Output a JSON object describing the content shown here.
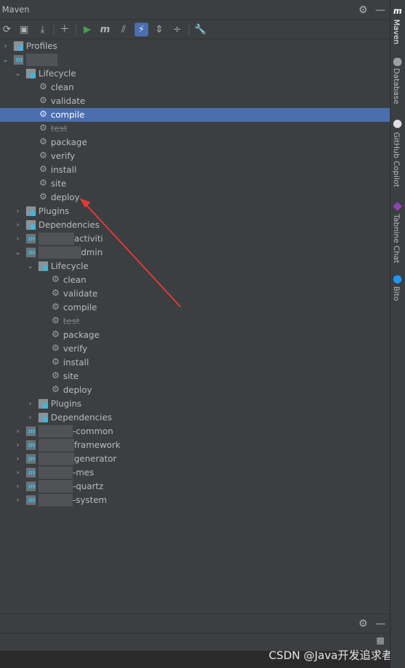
{
  "window": {
    "title": "Maven"
  },
  "header_icons": [
    "gear-icon",
    "minimize-icon"
  ],
  "toolbar": {
    "buttons": [
      "reload-icon",
      "add-project-icon",
      "download-icon",
      "add-icon",
      "run-icon",
      "maven-goal-icon",
      "toggle-offline-icon",
      "skip-tests-icon",
      "expand-all-icon",
      "collapse-all-icon",
      "settings-wrench-icon"
    ]
  },
  "tree": {
    "profiles": "Profiles",
    "root": {
      "lifecycle": "Lifecycle",
      "goals": [
        "clean",
        "validate",
        "compile",
        "test",
        "package",
        "verify",
        "install",
        "site",
        "deploy"
      ],
      "plugins": "Plugins",
      "dependencies": "Dependencies"
    },
    "modules": [
      {
        "suffix": "activiti"
      },
      {
        "suffix": "dmin"
      }
    ],
    "admin": {
      "lifecycle": "Lifecycle",
      "goals": [
        "clean",
        "validate",
        "compile",
        "test",
        "package",
        "verify",
        "install",
        "site",
        "deploy"
      ],
      "plugins": "Plugins",
      "dependencies": "Dependencies"
    },
    "more_modules": [
      "-common",
      "framework",
      "generator",
      "-mes",
      "-quartz",
      "-system"
    ]
  },
  "right_tabs": [
    "Maven",
    "Database",
    "GitHub Copilot",
    "Tabnine Chat",
    "Bito"
  ],
  "watermark": "CSDN @Java开发追求者",
  "colors": {
    "selection": "#4b6eaf",
    "background": "#3c3f41",
    "annotation_arrow": "#e53935"
  }
}
